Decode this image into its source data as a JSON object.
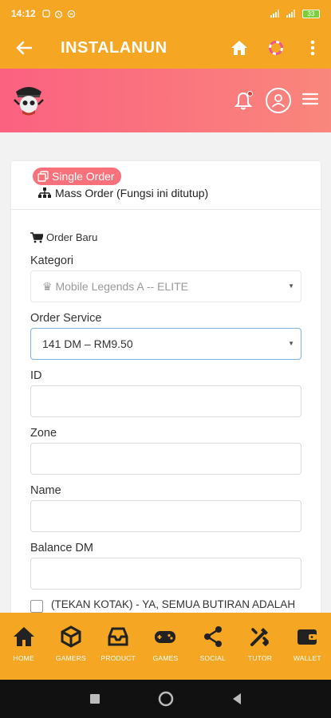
{
  "status_bar": {
    "time": "14:12",
    "battery": "33"
  },
  "app_bar": {
    "title": "INSTALANUN"
  },
  "tabs": {
    "single_order": "Single Order",
    "mass_order": "Mass Order (Fungsi ini ditutup)"
  },
  "form": {
    "section_title": "Order Baru",
    "kategori_label": "Kategori",
    "kategori_value": "♛ Mobile Legends A -- ELITE",
    "service_label": "Order Service",
    "service_value": "141 DM – RM9.50",
    "id_label": "ID",
    "zone_label": "Zone",
    "name_label": "Name",
    "balance_label": "Balance DM",
    "confirm_text": "(TEKAN KOTAK) - YA, SEMUA BUTIRAN ADALAH"
  },
  "bottom_nav": [
    {
      "label": "HOME",
      "icon": "home-icon"
    },
    {
      "label": "GAMERS",
      "icon": "unity-icon"
    },
    {
      "label": "PRODUCT",
      "icon": "inbox-icon"
    },
    {
      "label": "GAMES",
      "icon": "gamepad-icon"
    },
    {
      "label": "SOCIAL",
      "icon": "share-icon"
    },
    {
      "label": "TUTOR",
      "icon": "tools-icon"
    },
    {
      "label": "WALLET",
      "icon": "wallet-icon"
    }
  ],
  "colors": {
    "app_bar": "#f5a623",
    "header_start": "#fb6180",
    "header_end": "#f9877c",
    "accent_badge": "#f7707a"
  }
}
